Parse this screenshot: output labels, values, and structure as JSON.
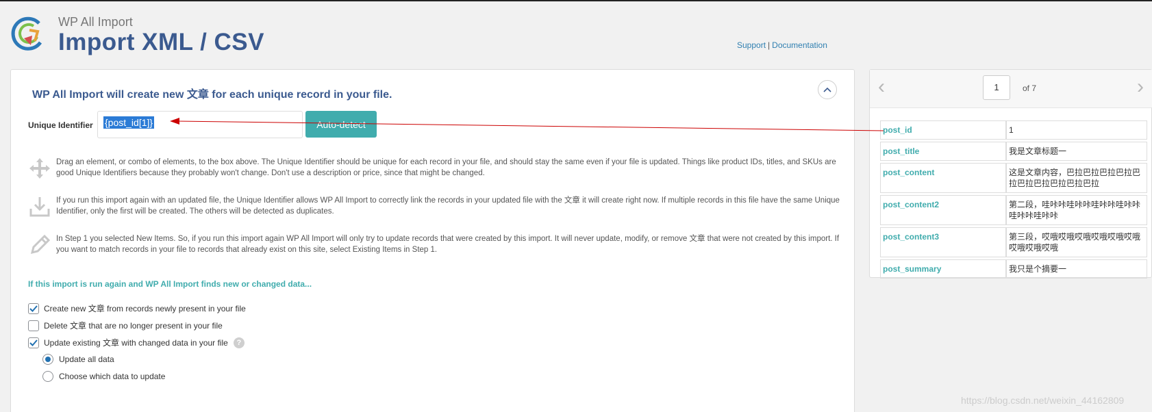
{
  "header": {
    "app_name": "WP All Import",
    "title": "Import XML / CSV",
    "support_label": "Support",
    "separator": "|",
    "documentation_label": "Documentation"
  },
  "main": {
    "heading": "WP All Import will create new 文章 for each unique record in your file.",
    "unique_identifier_label": "Unique Identifier",
    "unique_identifier_value": "{post_id[1]}",
    "auto_detect_label": "Auto-detect",
    "info": [
      {
        "icon": "drag-move-icon",
        "text": "Drag an element, or combo of elements, to the box above. The Unique Identifier should be unique for each record in your file, and should stay the same even if your file is updated. Things like product IDs, titles, and SKUs are good Unique Identifiers because they probably won't change. Don't use a description or price, since that might be changed."
      },
      {
        "icon": "download-tray-icon",
        "text": "If you run this import again with an updated file, the Unique Identifier allows WP All Import to correctly link the records in your updated file with the 文章 it will create right now. If multiple records in this file have the same Unique Identifier, only the first will be created. The others will be detected as duplicates."
      },
      {
        "icon": "pencil-icon",
        "text": "In Step 1 you selected New Items. So, if you run this import again WP All Import will only try to update records that were created by this import. It will never update, modify, or remove 文章 that were not created by this import. If you want to match records in your file to records that already exist on this site, select Existing Items in Step 1."
      }
    ],
    "import_again_heading": "If this import is run again and WP All Import finds new or changed data...",
    "options": [
      {
        "label": "Create new 文章 from records newly present in your file",
        "checked": true
      },
      {
        "label": "Delete 文章 that are no longer present in your file",
        "checked": false
      },
      {
        "label": "Update existing 文章 with changed data in your file",
        "checked": true
      }
    ],
    "help_icon": "?",
    "update_modes": [
      {
        "label": "Update all data",
        "selected": true
      },
      {
        "label": "Choose which data to update",
        "selected": false
      }
    ]
  },
  "preview": {
    "page": "1",
    "of_label": "of 7",
    "records": [
      {
        "key": "post_id",
        "value": "1"
      },
      {
        "key": "post_title",
        "value": "我是文章标题一"
      },
      {
        "key": "post_content",
        "value": "这是文章内容，巴拉巴拉巴拉巴拉巴拉巴拉巴拉巴拉巴拉巴拉"
      },
      {
        "key": "post_content2",
        "value": "第二段，哇咔咔哇咔咔哇咔咔哇咔咔哇咔咔哇咔咔"
      },
      {
        "key": "post_content3",
        "value": "第三段，哎哦哎哦哎哦哎哦哎哦哎哦哎哦哎哦哎哦"
      },
      {
        "key": "post_summary",
        "value": "我只是个摘要一"
      }
    ]
  },
  "watermark": "https://blog.csdn.net/weixin_44162809",
  "colors": {
    "title_blue": "#3b5a8f",
    "teal": "#40acad",
    "selection_blue": "#2b7bd6",
    "annotation_red": "#cc0000"
  }
}
